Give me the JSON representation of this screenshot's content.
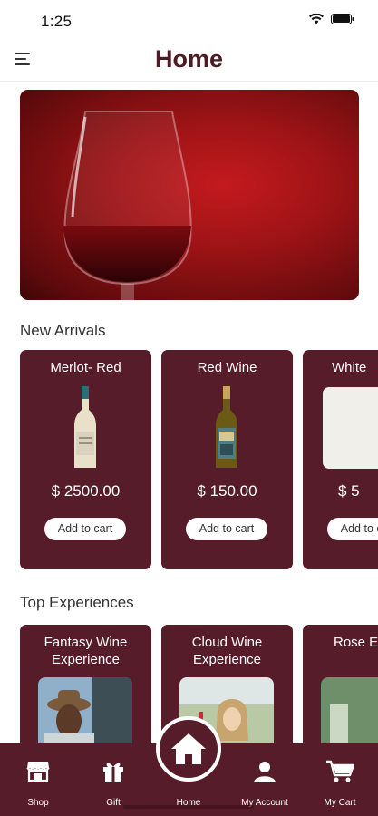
{
  "status_bar": {
    "time": "1:25"
  },
  "header": {
    "title": "Home"
  },
  "sections": {
    "new_arrivals": "New Arrivals",
    "top_experiences": "Top Experiences"
  },
  "products": [
    {
      "name": "Merlot- Red",
      "price": "$ 2500.00",
      "button": "Add to cart"
    },
    {
      "name": "Red Wine",
      "price": "$ 150.00",
      "button": "Add to cart"
    },
    {
      "name": "White",
      "price": "$ 5",
      "button": "Add to cart"
    }
  ],
  "experiences": [
    {
      "name": "Fantasy Wine Experience"
    },
    {
      "name": "Cloud Wine Experience"
    },
    {
      "name": "Rose Expe"
    }
  ],
  "tabs": [
    {
      "label": "Shop",
      "icon": "shop-icon"
    },
    {
      "label": "Gift",
      "icon": "gift-icon"
    },
    {
      "label": "Home",
      "icon": "home-icon"
    },
    {
      "label": "My Account",
      "icon": "account-icon"
    },
    {
      "label": "My Cart",
      "icon": "cart-icon"
    }
  ],
  "colors": {
    "brand": "#561c29",
    "title": "#4e1a24",
    "hero_red": "#b3171b"
  }
}
